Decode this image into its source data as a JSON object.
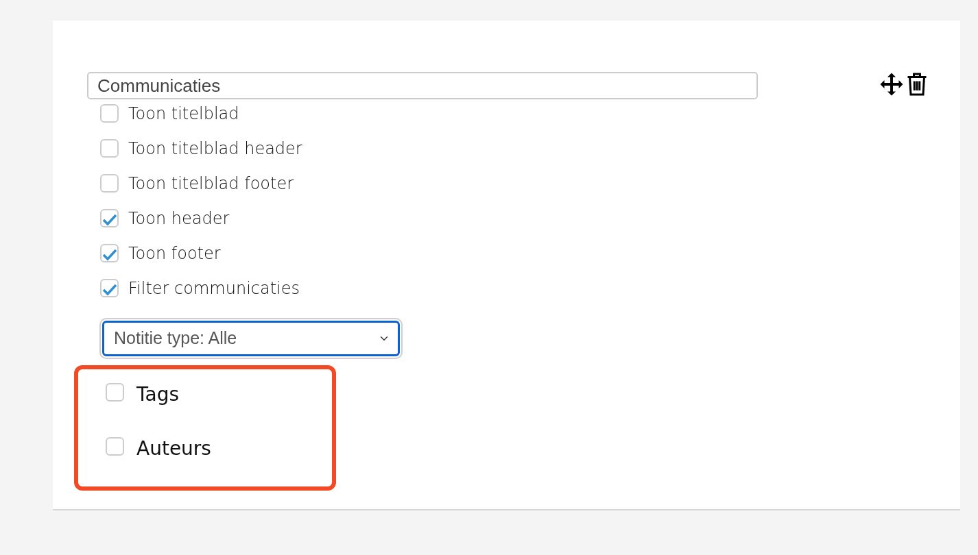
{
  "title_field": {
    "value": "Communicaties"
  },
  "options": [
    {
      "label": "Toon titelblad",
      "checked": false
    },
    {
      "label": "Toon titelblad header",
      "checked": false
    },
    {
      "label": "Toon titelblad footer",
      "checked": false
    },
    {
      "label": "Toon header",
      "checked": true
    },
    {
      "label": "Toon footer",
      "checked": true
    },
    {
      "label": "Filter communicaties",
      "checked": true
    }
  ],
  "type_select": {
    "value": "Notitie type: Alle",
    "focused": true
  },
  "highlight_group": {
    "highlighted": true,
    "options": [
      {
        "label": "Tags",
        "checked": false
      },
      {
        "label": "Auteurs",
        "checked": false
      }
    ]
  }
}
